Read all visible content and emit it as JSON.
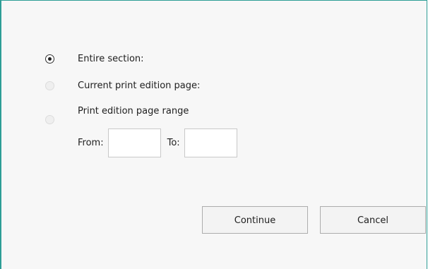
{
  "options": [
    {
      "label": "Entire section:",
      "selected": true
    },
    {
      "label": "Current print edition page:",
      "selected": false
    },
    {
      "label": "Print edition page range",
      "selected": false
    }
  ],
  "range": {
    "from_label": "From:",
    "from_value": "",
    "to_label": "To:",
    "to_value": ""
  },
  "buttons": {
    "continue_label": "Continue",
    "cancel_label": "Cancel"
  },
  "colors": {
    "accent_border": "#2e9e96",
    "background": "#f7f7f7"
  }
}
